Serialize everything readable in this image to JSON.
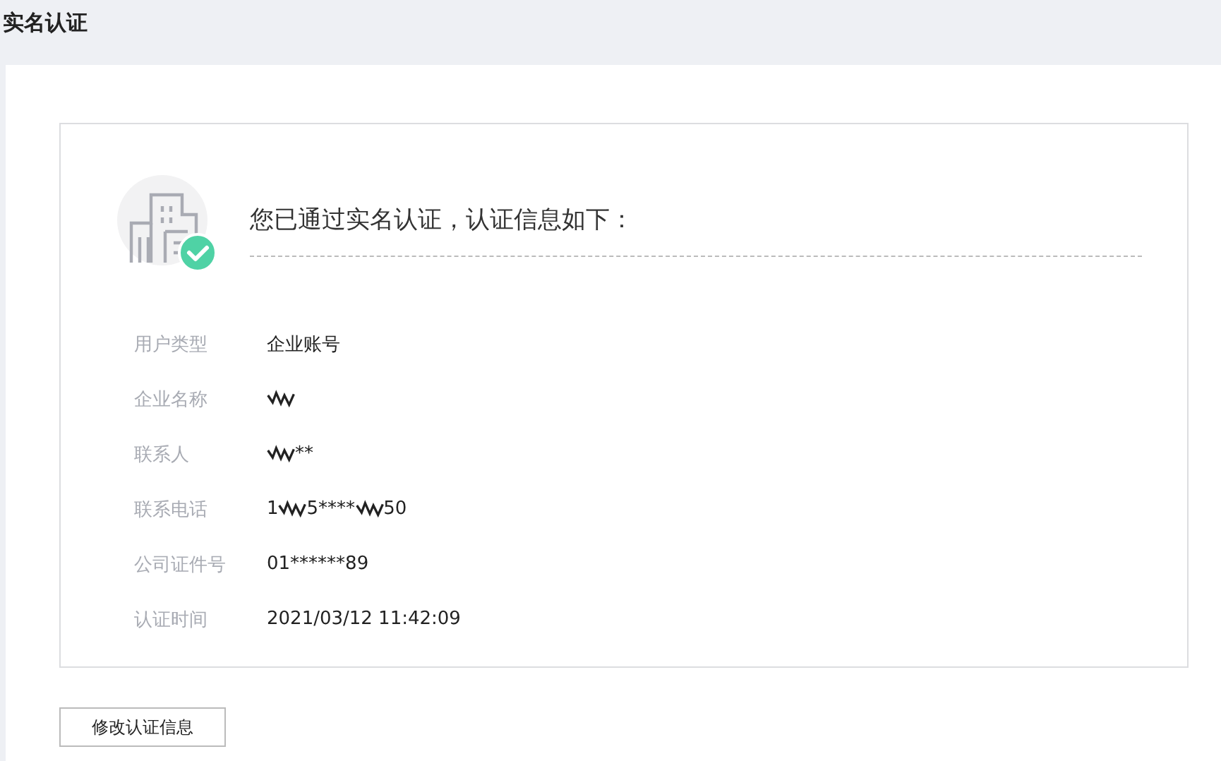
{
  "page_title": "实名认证",
  "card": {
    "heading": "您已通过实名认证，认证信息如下：",
    "verified": true,
    "rows": [
      {
        "label": "用户类型",
        "parts": [
          {
            "kind": "text",
            "text": "企业账号"
          }
        ]
      },
      {
        "label": "企业名称",
        "parts": [
          {
            "kind": "redacted"
          }
        ]
      },
      {
        "label": "联系人",
        "parts": [
          {
            "kind": "redacted"
          },
          {
            "kind": "text",
            "text": "**"
          }
        ]
      },
      {
        "label": "联系电话",
        "parts": [
          {
            "kind": "text",
            "text": "1"
          },
          {
            "kind": "redacted"
          },
          {
            "kind": "text",
            "text": "5****"
          },
          {
            "kind": "redacted"
          },
          {
            "kind": "text",
            "text": "50"
          }
        ]
      },
      {
        "label": "公司证件号",
        "parts": [
          {
            "kind": "text",
            "text": "01******89"
          }
        ]
      },
      {
        "label": "认证时间",
        "parts": [
          {
            "kind": "text",
            "text": "2021/03/12 11:42:09"
          }
        ]
      }
    ]
  },
  "button": "修改认证信息"
}
